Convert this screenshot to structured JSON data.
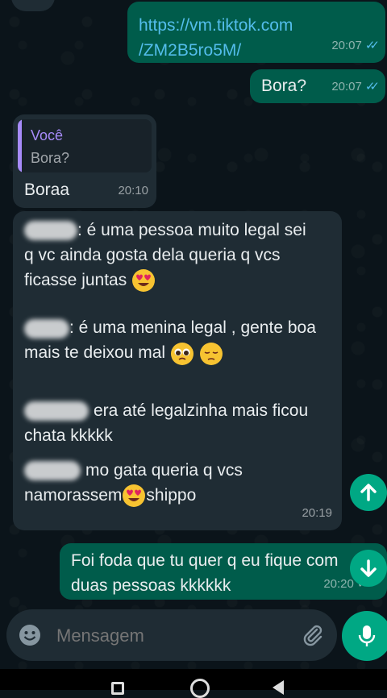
{
  "messages": {
    "link": {
      "line1": "https://vm.tiktok.com",
      "line2": "/ZM2B5ro5M/",
      "time": "20:07"
    },
    "bora": {
      "text": "Bora?",
      "time": "20:07"
    },
    "reply": {
      "quote_author": "Você",
      "quote_text": "Bora?",
      "text": "Boraa",
      "time": "20:10"
    },
    "long": {
      "p1a": ": é uma pessoa muito legal sei",
      "p1b": "q vc ainda gosta dela queria q vcs",
      "p1c": "ficasse juntas",
      "p2a": ": é uma menina legal , gente boa",
      "p2b": "mais te deixou mal",
      "p3a": "era até legalzinha mais ficou",
      "p3b": "chata kkkkk",
      "p4a": "mo gata queria q vcs",
      "p4b": "namorassem",
      "p4c": "shippo",
      "time": "20:19"
    },
    "last": {
      "line1": "Foi foda que tu quer q eu fique com",
      "line2": "duas pessoas kkkkkk",
      "time": "20:20"
    }
  },
  "composer": {
    "placeholder": "Mensagem"
  },
  "colors": {
    "outgoing": "#005c4b",
    "incoming": "#1f2c34",
    "accent": "#00a884",
    "read_ticks": "#53bdeb",
    "quote_bar": "#a78bfa"
  }
}
